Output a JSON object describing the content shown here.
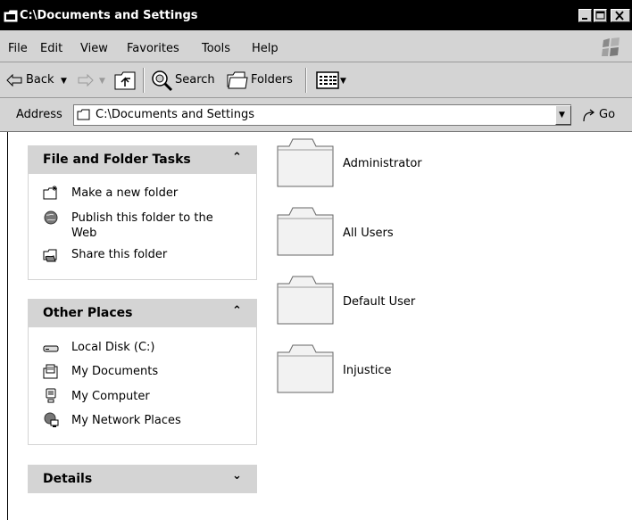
{
  "window": {
    "title": "C:\\Documents and Settings"
  },
  "menu": {
    "items": [
      "File",
      "Edit",
      "View",
      "Favorites",
      "Tools",
      "Help"
    ]
  },
  "toolbar": {
    "back_label": "Back",
    "search_label": "Search",
    "folders_label": "Folders"
  },
  "address": {
    "label": "Address",
    "value": "C:\\Documents and Settings",
    "go_label": "Go"
  },
  "tasks": {
    "file_folder": {
      "title": "File and Folder Tasks",
      "chevron": "⌃",
      "links": [
        {
          "label": "Make a new folder",
          "icon": "new-folder-icon"
        },
        {
          "label": "Publish this folder to the Web",
          "icon": "publish-web-icon"
        },
        {
          "label": "Share this folder",
          "icon": "share-folder-icon"
        }
      ]
    },
    "other_places": {
      "title": "Other Places",
      "links": [
        {
          "label": "Local Disk (C:)",
          "icon": "local-disk-icon"
        },
        {
          "label": "My Documents",
          "icon": "my-documents-icon"
        },
        {
          "label": "My Computer",
          "icon": "my-computer-icon"
        },
        {
          "label": "My Network Places",
          "icon": "network-places-icon"
        }
      ]
    },
    "details": {
      "title": "Details"
    }
  },
  "folders": [
    {
      "name": "Administrator"
    },
    {
      "name": "All Users"
    },
    {
      "name": "Default User"
    },
    {
      "name": "Injustice"
    }
  ]
}
